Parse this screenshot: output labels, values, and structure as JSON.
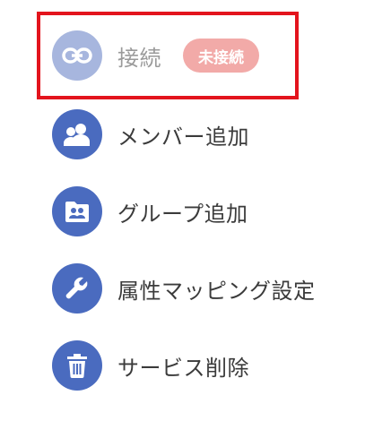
{
  "menu": {
    "connect": {
      "label": "接続",
      "badge": "未接続",
      "icon": "link-icon"
    },
    "add_member": {
      "label": "メンバー追加",
      "icon": "people-icon"
    },
    "add_group": {
      "label": "グループ追加",
      "icon": "group-folder-icon"
    },
    "attribute_mapping": {
      "label": "属性マッピング設定",
      "icon": "wrench-icon"
    },
    "delete_service": {
      "label": "サービス削除",
      "icon": "trash-icon"
    }
  },
  "colors": {
    "icon_active": "#4a6bbf",
    "icon_disabled": "#a7b6de",
    "badge_bg": "#f2aaa8",
    "highlight_border": "#e3141d"
  }
}
